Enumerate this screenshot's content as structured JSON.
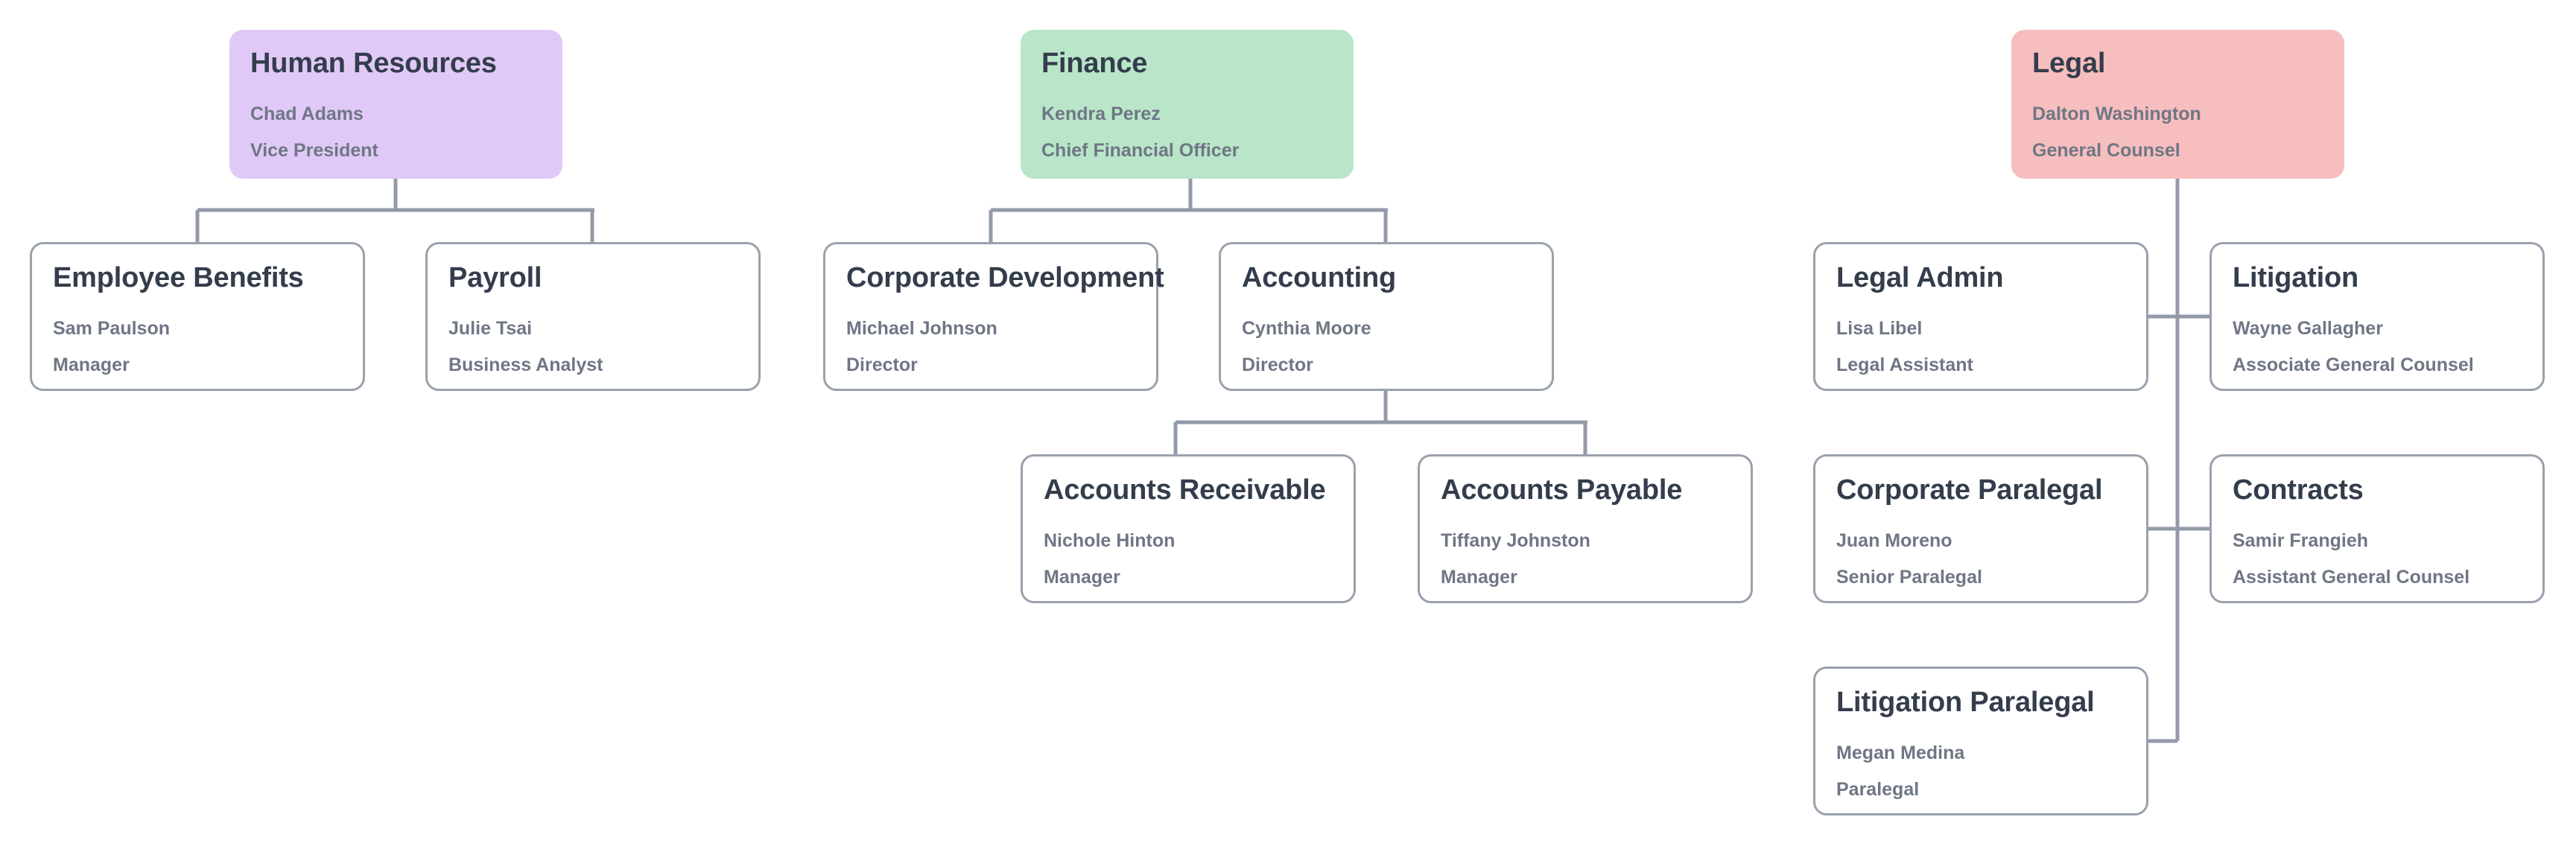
{
  "theme": {
    "background": "#ffffff",
    "line_color": "#939aa8",
    "card_border": "#9aa1ad",
    "title_color": "#343d4c",
    "subtitle_color": "#6f7685",
    "hr_fill": "#e0c9f7",
    "finance_fill": "#b9e5c9",
    "legal_fill": "#f6bebe"
  },
  "org_chart": {
    "type": "org-hierarchy",
    "branches": [
      {
        "key": "human_resources",
        "root": {
          "title": "Human Resources",
          "person": "Chad Adams",
          "role": "Vice President"
        },
        "children": [
          {
            "title": "Employee Benefits",
            "person": "Sam Paulson",
            "role": "Manager"
          },
          {
            "title": "Payroll",
            "person": "Julie Tsai",
            "role": "Business Analyst"
          }
        ]
      },
      {
        "key": "finance",
        "root": {
          "title": "Finance",
          "person": "Kendra Perez",
          "role": "Chief Financial Officer"
        },
        "children": [
          {
            "title": "Corporate Development",
            "person": "Michael Johnson",
            "role": "Director"
          },
          {
            "title": "Accounting",
            "person": "Cynthia Moore",
            "role": "Director",
            "children": [
              {
                "title": "Accounts Receivable",
                "person": "Nichole Hinton",
                "role": "Manager"
              },
              {
                "title": "Accounts Payable",
                "person": "Tiffany Johnston",
                "role": "Manager"
              }
            ]
          }
        ]
      },
      {
        "key": "legal",
        "root": {
          "title": "Legal",
          "person": "Dalton Washington",
          "role": "General Counsel"
        },
        "children": [
          {
            "title": "Legal Admin",
            "person": "Lisa Libel",
            "role": "Legal Assistant"
          },
          {
            "title": "Litigation",
            "person": "Wayne Gallagher",
            "role": "Associate General Counsel"
          },
          {
            "title": "Corporate Paralegal",
            "person": "Juan Moreno",
            "role": "Senior Paralegal"
          },
          {
            "title": "Contracts",
            "person": "Samir Frangieh",
            "role": "Assistant General Counsel"
          },
          {
            "title": "Litigation Paralegal",
            "person": "Megan Medina",
            "role": "Paralegal"
          }
        ]
      }
    ]
  },
  "nodes": {
    "human_resources": {
      "title": "Human Resources",
      "person": "Chad Adams",
      "role": "Vice President"
    },
    "employee_benefits": {
      "title": "Employee Benefits",
      "person": "Sam Paulson",
      "role": "Manager"
    },
    "payroll": {
      "title": "Payroll",
      "person": "Julie Tsai",
      "role": "Business Analyst"
    },
    "finance": {
      "title": "Finance",
      "person": "Kendra Perez",
      "role": "Chief Financial Officer"
    },
    "corporate_development": {
      "title": "Corporate Development",
      "person": "Michael Johnson",
      "role": "Director"
    },
    "accounting": {
      "title": "Accounting",
      "person": "Cynthia Moore",
      "role": "Director"
    },
    "accounts_receivable": {
      "title": "Accounts Receivable",
      "person": "Nichole Hinton",
      "role": "Manager"
    },
    "accounts_payable": {
      "title": "Accounts Payable",
      "person": "Tiffany Johnston",
      "role": "Manager"
    },
    "legal": {
      "title": "Legal",
      "person": "Dalton Washington",
      "role": "General Counsel"
    },
    "legal_admin": {
      "title": "Legal Admin",
      "person": "Lisa Libel",
      "role": "Legal Assistant"
    },
    "litigation": {
      "title": "Litigation",
      "person": "Wayne Gallagher",
      "role": "Associate General Counsel"
    },
    "corporate_paralegal": {
      "title": "Corporate Paralegal",
      "person": "Juan Moreno",
      "role": "Senior Paralegal"
    },
    "contracts": {
      "title": "Contracts",
      "person": "Samir Frangieh",
      "role": "Assistant General Counsel"
    },
    "litigation_paralegal": {
      "title": "Litigation Paralegal",
      "person": "Megan Medina",
      "role": "Paralegal"
    }
  }
}
